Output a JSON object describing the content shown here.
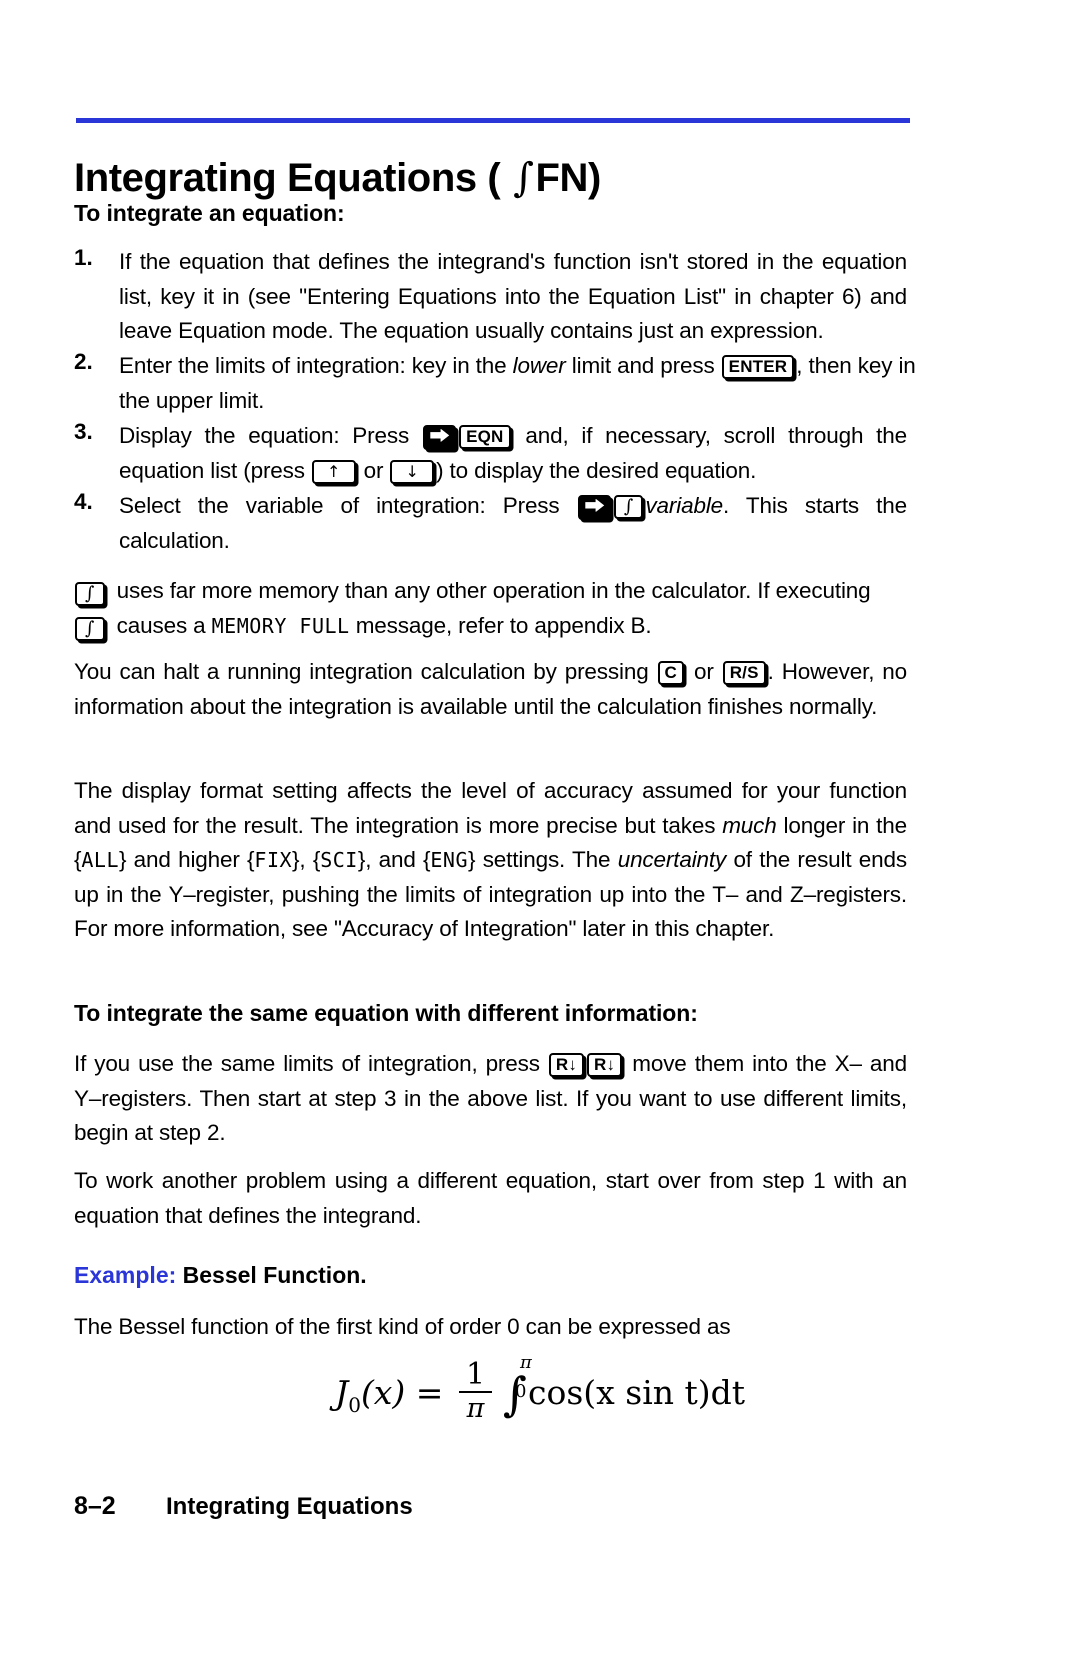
{
  "document": {
    "title_prefix": "Integrating Equations ( ",
    "title_symbol": "∫",
    "title_suffix": "FN)",
    "accent_color": "#2b36d8"
  },
  "section_to_integrate": {
    "heading": "To integrate an equation:",
    "steps": [
      {
        "number": "1.",
        "text": "If the equation that defines the integrand's function isn't stored in the equation list, key it in (see \"Entering Equations into the Equation List\" in chapter 6) and leave Equation mode. The equation usually contains just an expression."
      },
      {
        "number": "2.",
        "part_a": "Enter the limits of integration:   key in the ",
        "emphasis": "lower",
        "part_b": " limit and press ",
        "key": "ENTER",
        "part_c": ", then key in the upper limit."
      },
      {
        "number": "3.",
        "part_a": "Display the equation: Press ",
        "key_shift": "⮕",
        "key_eqn": "EQN",
        "part_b": " and, if necessary, scroll through the equation list (press ",
        "key_up": "↑",
        "part_c": " or ",
        "key_down": "↓",
        "part_d": ") to display the desired equation."
      },
      {
        "number": "4.",
        "part_a": "Select the variable of integration: Press ",
        "key_shift": "⮕",
        "key_integral": "∫",
        "emphasis": "variable",
        "part_b": ". This starts the calculation."
      }
    ]
  },
  "memory_note": {
    "key_integral": "∫",
    "line1_a": " uses far more memory than any other operation in the calculator. If executing ",
    "line2_a": " causes a ",
    "lcd_message": "MEMORY FULL",
    "line2_b": " message, refer to appendix B."
  },
  "halt_note": {
    "part_a": "You can halt a running integration calculation by pressing ",
    "key_c": "C",
    "part_b": " or ",
    "key_rs": "R/S",
    "part_c": ". However, no information about the integration is available until the calculation finishes normally."
  },
  "display_format_note": {
    "part_a": "The display format setting affects the level of accuracy assumed for your function and used for the result. The integration is more precise but takes ",
    "emph_much": "much",
    "part_b": " longer in the {",
    "lcd_all": "ALL",
    "part_c": "} and higher {",
    "lcd_fix": "FIX",
    "part_d": "}, {",
    "lcd_sci": "SCI",
    "part_e": "}, and {",
    "lcd_eng": "ENG",
    "part_f": "} settings. The ",
    "emph_uncertainty": "uncertainty",
    "part_g": " of the result ends up in the Y–register, pushing the limits of integration up into the T– and Z–registers. For more information, see \"Accuracy of Integration\" later in this chapter."
  },
  "section_same_equation": {
    "heading": "To integrate the same equation with different information:",
    "para1_a": "If you use the same limits of integration, press ",
    "key_rolldown_1": "R↓",
    "key_rolldown_2": "R↓",
    "para1_b": " move them into the X– and Y–registers. Then start at step 3 in the above list. If you want to use different limits, begin at step 2.",
    "para2": "To work another problem using a different equation, start over from step 1 with an equation that defines the integrand."
  },
  "example": {
    "label": "Example:",
    "title": " Bessel Function.",
    "intro": "The Bessel function of the first kind of order 0 can be expressed as",
    "formula": {
      "function_name": "J",
      "order_subscript": "0",
      "variable": "(x) = ",
      "fraction_numerator": "1",
      "fraction_denominator": "π",
      "integral_symbol": "∫",
      "upper_limit": "π",
      "lower_limit": "0",
      "integrand": "cos(x sin t)dt"
    }
  },
  "footer": {
    "page_number": "8–2",
    "section_name": "Integrating Equations"
  }
}
